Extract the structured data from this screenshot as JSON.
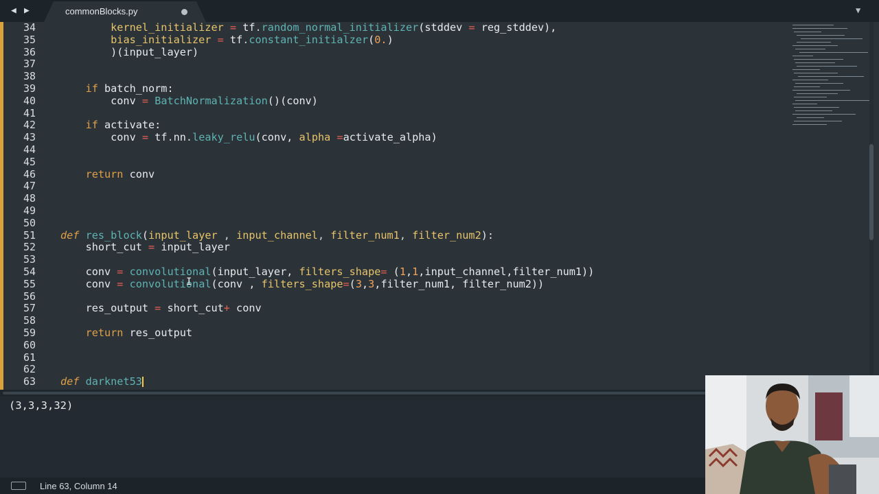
{
  "tab": {
    "title": "commonBlocks.py",
    "nav_back": "◀",
    "nav_forward": "▶",
    "menu": "▼"
  },
  "editor": {
    "line_numbers": [
      "34",
      "35",
      "36",
      "37",
      "38",
      "39",
      "40",
      "41",
      "42",
      "43",
      "44",
      "45",
      "46",
      "47",
      "48",
      "49",
      "50",
      "51",
      "52",
      "53",
      "54",
      "55",
      "56",
      "57",
      "58",
      "59",
      "60",
      "61",
      "62",
      "63"
    ],
    "lines": [
      [
        {
          "t": "        "
        },
        {
          "t": "kernel_initializer",
          "c": "vr"
        },
        {
          "t": " "
        },
        {
          "t": "=",
          "c": "op"
        },
        {
          "t": " tf"
        },
        {
          "t": ".",
          "c": "dm"
        },
        {
          "t": "random_normal_initializer",
          "c": "fn"
        },
        {
          "t": "(stddev "
        },
        {
          "t": "=",
          "c": "op"
        },
        {
          "t": " reg_stddev),"
        }
      ],
      [
        {
          "t": "        "
        },
        {
          "t": "bias_initializer",
          "c": "vr"
        },
        {
          "t": " "
        },
        {
          "t": "=",
          "c": "op"
        },
        {
          "t": " tf"
        },
        {
          "t": ".",
          "c": "dm"
        },
        {
          "t": "constant_initialzer",
          "c": "fn"
        },
        {
          "t": "("
        },
        {
          "t": "0.",
          "c": "nm"
        },
        {
          "t": ")"
        }
      ],
      [
        {
          "t": "        )(input_layer)"
        }
      ],
      [],
      [],
      [
        {
          "t": "    "
        },
        {
          "t": "if",
          "c": "kw"
        },
        {
          "t": " batch_norm:"
        }
      ],
      [
        {
          "t": "        conv "
        },
        {
          "t": "=",
          "c": "op"
        },
        {
          "t": " "
        },
        {
          "t": "BatchNormalization",
          "c": "fn"
        },
        {
          "t": "()(conv)"
        }
      ],
      [],
      [
        {
          "t": "    "
        },
        {
          "t": "if",
          "c": "kw"
        },
        {
          "t": " activate:"
        }
      ],
      [
        {
          "t": "        conv "
        },
        {
          "t": "=",
          "c": "op"
        },
        {
          "t": " tf"
        },
        {
          "t": ".",
          "c": "dm"
        },
        {
          "t": "nn"
        },
        {
          "t": ".",
          "c": "dm"
        },
        {
          "t": "leaky_relu",
          "c": "fn"
        },
        {
          "t": "(conv, "
        },
        {
          "t": "alpha",
          "c": "vr"
        },
        {
          "t": " "
        },
        {
          "t": "=",
          "c": "op"
        },
        {
          "t": "activate_alpha)"
        }
      ],
      [],
      [],
      [
        {
          "t": "    "
        },
        {
          "t": "return",
          "c": "kw"
        },
        {
          "t": " conv"
        }
      ],
      [],
      [],
      [],
      [],
      [
        {
          "t": "def",
          "c": "kwi"
        },
        {
          "t": " "
        },
        {
          "t": "res_block",
          "c": "fn"
        },
        {
          "t": "("
        },
        {
          "t": "input_layer",
          "c": "vr"
        },
        {
          "t": " , ",
          "c": "dm"
        },
        {
          "t": "input_channel",
          "c": "vr"
        },
        {
          "t": ", ",
          "c": "dm"
        },
        {
          "t": "filter_num1",
          "c": "vr"
        },
        {
          "t": ", ",
          "c": "dm"
        },
        {
          "t": "filter_num2",
          "c": "vr"
        },
        {
          "t": "):"
        }
      ],
      [
        {
          "t": "    short_cut "
        },
        {
          "t": "=",
          "c": "op"
        },
        {
          "t": " input_layer"
        }
      ],
      [],
      [
        {
          "t": "    conv "
        },
        {
          "t": "=",
          "c": "op"
        },
        {
          "t": " "
        },
        {
          "t": "convolutional",
          "c": "fn"
        },
        {
          "t": "(input_layer, "
        },
        {
          "t": "filters_shape",
          "c": "vr"
        },
        {
          "t": "=",
          "c": "op"
        },
        {
          "t": " ("
        },
        {
          "t": "1",
          "c": "nm"
        },
        {
          "t": ","
        },
        {
          "t": "1",
          "c": "nm"
        },
        {
          "t": ",input_channel,filter_num1))"
        }
      ],
      [
        {
          "t": "    conv "
        },
        {
          "t": "=",
          "c": "op"
        },
        {
          "t": " "
        },
        {
          "t": "convolutional",
          "c": "fn"
        },
        {
          "t": "(conv , "
        },
        {
          "t": "filters_shape",
          "c": "vr"
        },
        {
          "t": "=",
          "c": "op"
        },
        {
          "t": "("
        },
        {
          "t": "3",
          "c": "nm"
        },
        {
          "t": ","
        },
        {
          "t": "3",
          "c": "nm"
        },
        {
          "t": ",filter_num1, filter_num2))"
        }
      ],
      [],
      [
        {
          "t": "    res_output "
        },
        {
          "t": "=",
          "c": "op"
        },
        {
          "t": " short_cut"
        },
        {
          "t": "+",
          "c": "op"
        },
        {
          "t": " conv"
        }
      ],
      [],
      [
        {
          "t": "    "
        },
        {
          "t": "return",
          "c": "kw"
        },
        {
          "t": " res_output"
        }
      ],
      [],
      [],
      [],
      [
        {
          "t": "def",
          "c": "kwi"
        },
        {
          "t": " "
        },
        {
          "t": "darknet53",
          "c": "fn"
        },
        {
          "cursor": true
        }
      ]
    ]
  },
  "console": {
    "output": "(3,3,3,32)"
  },
  "status": {
    "position": "Line 63, Column 14"
  },
  "colors": {
    "editor_bg": "#2b3339",
    "keyword": "#e0a048",
    "function": "#5fb3b3",
    "variable": "#e8c46a",
    "operator": "#e45e52",
    "number": "#f1a45c",
    "modified_marker": "#d9a23c"
  }
}
